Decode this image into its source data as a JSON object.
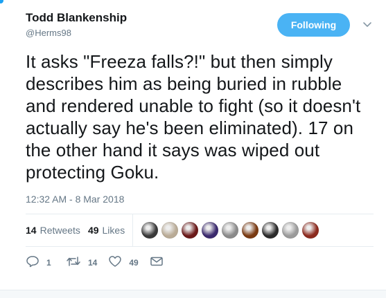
{
  "author": {
    "name": "Todd Blankenship",
    "handle": "@Herms98"
  },
  "follow_button": {
    "label": "Following"
  },
  "tweet": {
    "text": "It asks \"Freeza falls?!\" but then simply describes him as being buried in rubble and rendered unable to fight (so it doesn't actually say he's been eliminated). 17 on the other hand it says was wiped out protecting Goku.",
    "timestamp": "12:32 AM - 8 Mar 2018"
  },
  "stats": {
    "retweets_count": "14",
    "retweets_label": "Retweets",
    "likes_count": "49",
    "likes_label": "Likes"
  },
  "liker_avatars": [
    {
      "color": "#3a3a3a"
    },
    {
      "color": "#b9ab96"
    },
    {
      "color": "#6b1a1a"
    },
    {
      "color": "#3b2a6e"
    },
    {
      "color": "#8a8a8a"
    },
    {
      "color": "#7a3a12"
    },
    {
      "color": "#2b2b2b"
    },
    {
      "color": "#9a9a9a"
    },
    {
      "color": "#8c2a1e"
    }
  ],
  "actions": {
    "reply_count": "1",
    "retweet_count": "14",
    "like_count": "49"
  },
  "colors": {
    "accent": "#1da1f2",
    "follow_button": "#4ab3f4",
    "muted": "#657786"
  }
}
